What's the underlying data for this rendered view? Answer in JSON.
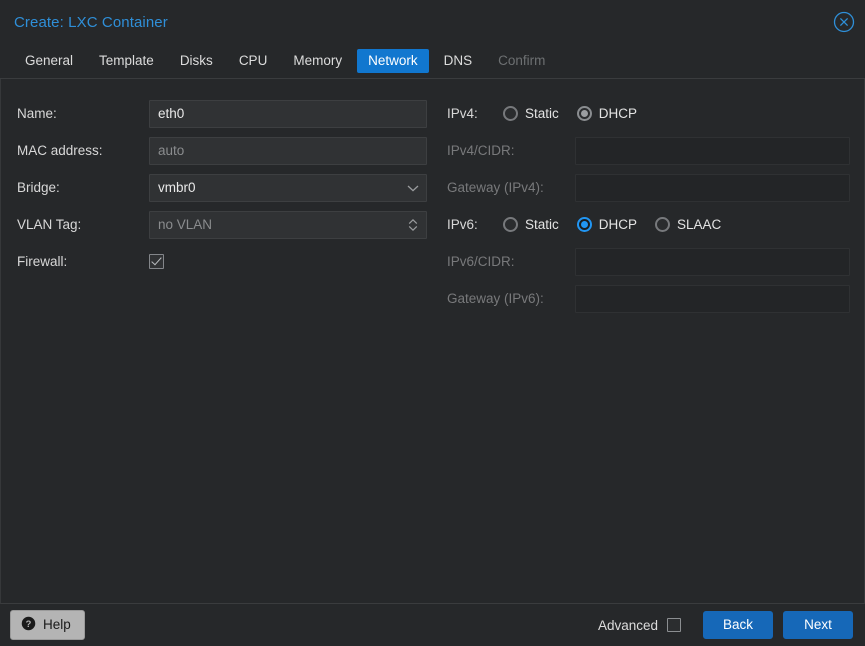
{
  "window": {
    "title": "Create: LXC Container",
    "close_icon": "close-circle-icon"
  },
  "tabs": [
    {
      "label": "General",
      "state": "normal"
    },
    {
      "label": "Template",
      "state": "normal"
    },
    {
      "label": "Disks",
      "state": "normal"
    },
    {
      "label": "CPU",
      "state": "normal"
    },
    {
      "label": "Memory",
      "state": "normal"
    },
    {
      "label": "Network",
      "state": "active"
    },
    {
      "label": "DNS",
      "state": "normal"
    },
    {
      "label": "Confirm",
      "state": "disabled"
    }
  ],
  "left_column": {
    "name": {
      "label": "Name:",
      "value": "eth0"
    },
    "mac_address": {
      "label": "MAC address:",
      "placeholder": "auto",
      "value": ""
    },
    "bridge": {
      "label": "Bridge:",
      "value": "vmbr0",
      "caret_icon": "chevron-down-icon"
    },
    "vlan_tag": {
      "label": "VLAN Tag:",
      "placeholder": "no VLAN",
      "value": "",
      "spinner_icon": "spinner-updown-icon"
    },
    "firewall": {
      "label": "Firewall:",
      "checked": true
    }
  },
  "right_column": {
    "ipv4": {
      "label": "IPv4:",
      "options": [
        "Static",
        "DHCP"
      ],
      "selected": "DHCP",
      "focused": false
    },
    "ipv4_cidr": {
      "label": "IPv4/CIDR:",
      "value": "",
      "disabled": true
    },
    "ipv4_gateway": {
      "label": "Gateway (IPv4):",
      "value": "",
      "disabled": true
    },
    "ipv6": {
      "label": "IPv6:",
      "options": [
        "Static",
        "DHCP",
        "SLAAC"
      ],
      "selected": "DHCP",
      "focused": true
    },
    "ipv6_cidr": {
      "label": "IPv6/CIDR:",
      "value": "",
      "disabled": true
    },
    "ipv6_gateway": {
      "label": "Gateway (IPv6):",
      "value": "",
      "disabled": true
    }
  },
  "footer": {
    "help_label": "Help",
    "help_icon": "question-circle-icon",
    "advanced_label": "Advanced",
    "advanced_checked": false,
    "back_label": "Back",
    "next_label": "Next"
  },
  "colors": {
    "accent_blue": "#1177cf",
    "button_blue": "#1668b8",
    "title_blue": "#2f8fd8",
    "radio_blue": "#2196f3",
    "window_bg": "#26282a",
    "field_bg": "#303234",
    "field_disabled_bg": "#232527"
  }
}
